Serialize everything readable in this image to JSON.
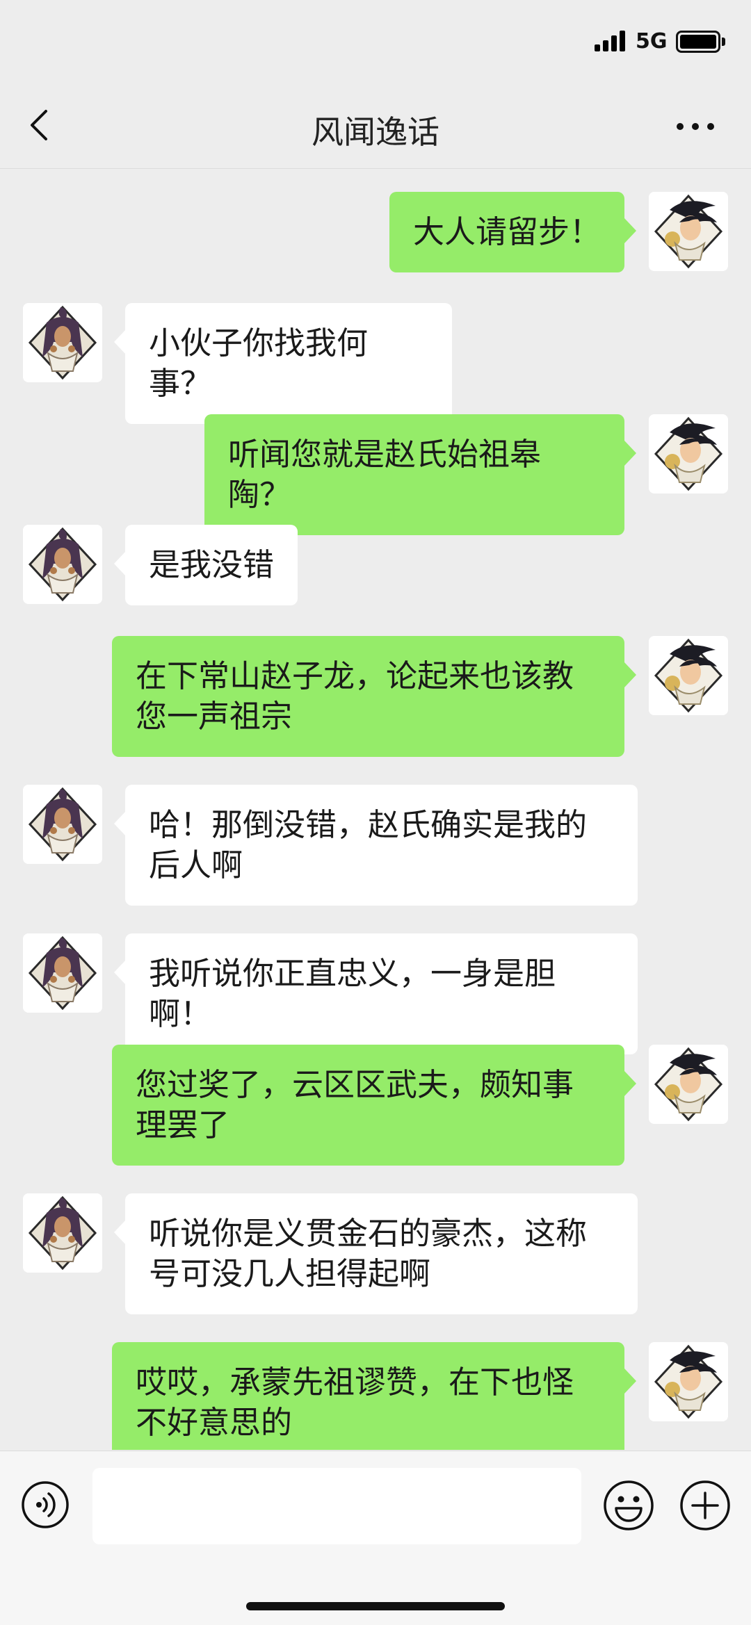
{
  "status_bar": {
    "network": "5G",
    "signal_bars": 4,
    "battery_level": 1.0
  },
  "header": {
    "title": "风闻逸话"
  },
  "messages": [
    {
      "side": "right",
      "text": "大人请留步！"
    },
    {
      "side": "left",
      "text": "小伙子你找我何事？"
    },
    {
      "side": "right",
      "text": "听闻您就是赵氏始祖皋陶？"
    },
    {
      "side": "left",
      "text": "是我没错"
    },
    {
      "side": "right",
      "text": "在下常山赵子龙，论起来也该教您一声祖宗"
    },
    {
      "side": "left",
      "text": "哈！那倒没错，赵氏确实是我的后人啊"
    },
    {
      "side": "left",
      "text": "我听说你正直忠义，一身是胆啊！"
    },
    {
      "side": "right",
      "text": "您过奖了，云区区武夫，颇知事理罢了"
    },
    {
      "side": "left",
      "text": "听说你是义贯金石的豪杰，这称号可没几人担得起啊"
    },
    {
      "side": "right",
      "text": "哎哎，承蒙先祖谬赞，在下也怪不好意思的"
    }
  ],
  "input": {
    "value": "",
    "placeholder": ""
  },
  "colors": {
    "background": "#ededed",
    "sent_bubble": "#95ec69",
    "received_bubble": "#ffffff"
  }
}
